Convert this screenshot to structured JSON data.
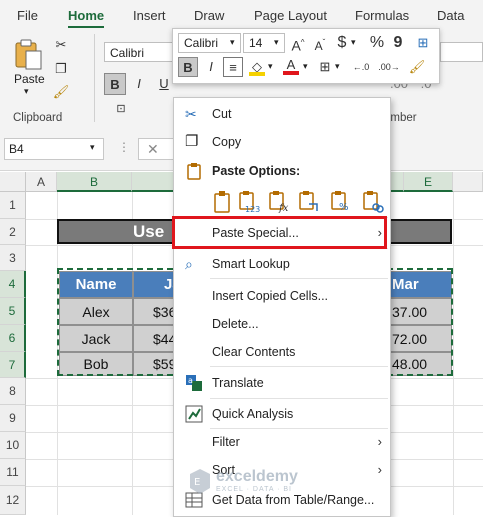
{
  "ribbon": {
    "tabs": [
      "File",
      "Home",
      "Insert",
      "Draw",
      "Page Layout",
      "Formulas",
      "Data"
    ],
    "active_tab": "Home",
    "font_name": "Calibri",
    "paste_label": "Paste",
    "clipboard_label": "Clipboard",
    "number_label": "umber",
    "bold_label": "B",
    "italic_label": "I"
  },
  "formula_bar": {
    "name_box": "B4"
  },
  "grid": {
    "columns": [
      "A",
      "B",
      "",
      "",
      "E"
    ],
    "rows": [
      "1",
      "2",
      "3",
      "4",
      "5",
      "6",
      "7",
      "8",
      "9",
      "10",
      "11",
      "12"
    ],
    "title_text": "Use",
    "table": {
      "headers": [
        "Name",
        "Ja",
        "Mar"
      ],
      "rows": [
        [
          "Alex",
          "$36",
          "37.00"
        ],
        [
          "Jack",
          "$44",
          "72.00"
        ],
        [
          "Bob",
          "$59",
          "48.00"
        ]
      ]
    }
  },
  "mini_toolbar": {
    "font": "Calibri",
    "size": "14",
    "bold": "B",
    "italic": "I",
    "currency": "$",
    "percent": "%",
    "comma": "9",
    "font_color": "#e0161c",
    "fill_color": "#f5d100"
  },
  "context_menu": {
    "cut": "Cut",
    "copy": "Copy",
    "paste_options": "Paste Options:",
    "paste_special": "Paste Special...",
    "smart_lookup": "Smart Lookup",
    "insert_copied": "Insert Copied Cells...",
    "delete": "Delete...",
    "clear_contents": "Clear Contents",
    "translate": "Translate",
    "quick_analysis": "Quick Analysis",
    "filter": "Filter",
    "sort": "Sort",
    "get_data": "Get Data from Table/Range...",
    "highlight_color": "#e0161c"
  },
  "watermark": {
    "brand": "exceldemy",
    "tagline": "EXCEL · DATA · BI"
  }
}
